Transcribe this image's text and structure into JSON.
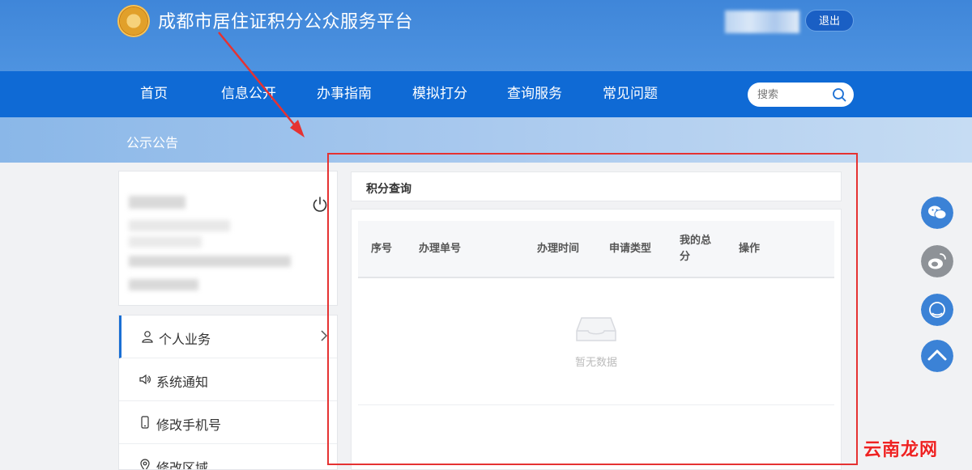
{
  "header": {
    "site_title": "成都市居住证积分公众服务平台",
    "logout_label": "退出"
  },
  "nav": {
    "items": [
      {
        "label": "首页"
      },
      {
        "label": "信息公开"
      },
      {
        "label": "办事指南"
      },
      {
        "label": "模拟打分"
      },
      {
        "label": "查询服务"
      },
      {
        "label": "常见问题"
      }
    ],
    "search_placeholder": "搜索"
  },
  "banner": {
    "title": "公示公告"
  },
  "sidebar": {
    "menu": [
      {
        "label": "个人业务",
        "icon": "user-icon",
        "active": true
      },
      {
        "label": "系统通知",
        "icon": "speaker-icon"
      },
      {
        "label": "修改手机号",
        "icon": "phone-icon"
      },
      {
        "label": "修改区域",
        "icon": "location-icon"
      }
    ]
  },
  "main": {
    "title": "积分查询",
    "columns": [
      "序号",
      "办理单号",
      "办理时间",
      "申请类型",
      "我的总分",
      "操作"
    ],
    "empty_text": "暂无数据"
  },
  "watermark": "云南龙网",
  "colors": {
    "nav_bg": "#0f6ad5",
    "header_bg": "#3f86d9",
    "annotation_red": "#e53232"
  }
}
